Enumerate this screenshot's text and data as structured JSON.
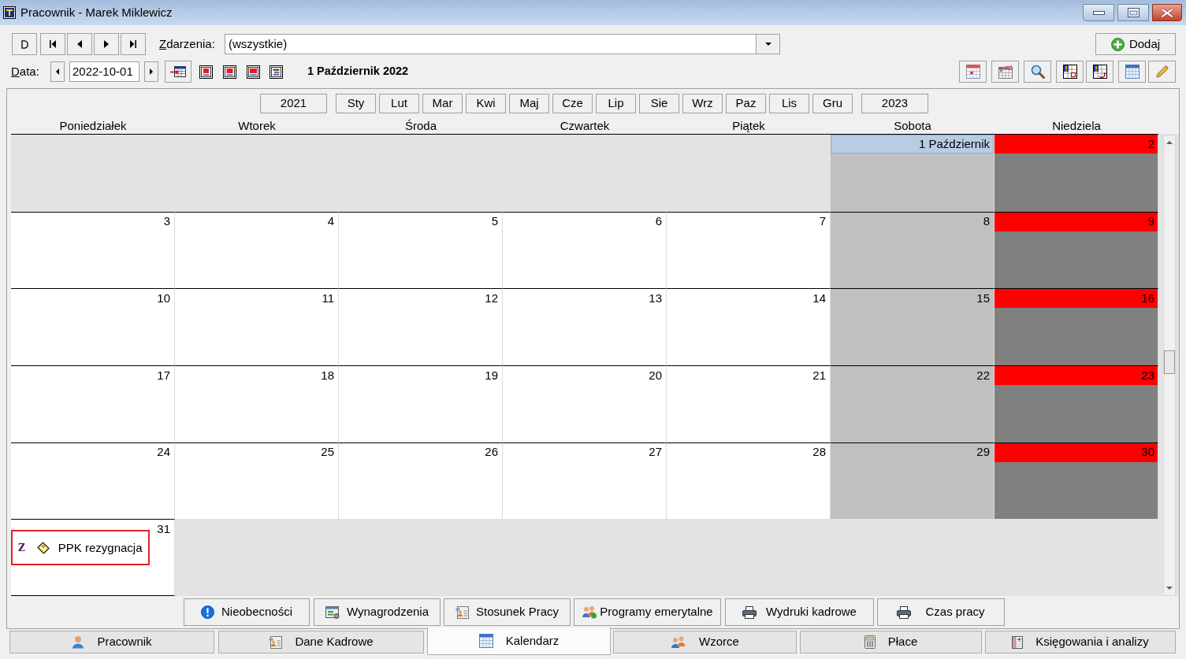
{
  "window": {
    "title": "Pracownik - Marek Miklewicz"
  },
  "toolbar": {
    "events_label": "Zdarzenia:",
    "events_filter": {
      "value": "(wszystkie)"
    },
    "add_button": "Dodaj"
  },
  "date_bar": {
    "label": "Data:",
    "date": {
      "value": "2022-10-01"
    },
    "heading": "1 Październik 2022"
  },
  "period_bar": {
    "previous_year": "2021",
    "months": [
      "Sty",
      "Lut",
      "Mar",
      "Kwi",
      "Maj",
      "Cze",
      "Lip",
      "Sie",
      "Wrz",
      "Paz",
      "Lis",
      "Gru"
    ],
    "next_year": "2023"
  },
  "calendar": {
    "weekdays": [
      "Poniedziałek",
      "Wtorek",
      "Środa",
      "Czwartek",
      "Piątek",
      "Sobota",
      "Niedziela"
    ],
    "weeks": [
      {
        "days": [
          {
            "kind": "outside"
          },
          {
            "kind": "outside"
          },
          {
            "kind": "outside"
          },
          {
            "kind": "outside"
          },
          {
            "kind": "outside"
          },
          {
            "kind": "saturday",
            "day": "1 Październik",
            "selected": true
          },
          {
            "kind": "sunday",
            "day": "2",
            "selected": false
          }
        ]
      },
      {
        "days": [
          {
            "kind": "weekday",
            "day": "3",
            "selected": false
          },
          {
            "kind": "weekday",
            "day": "4",
            "selected": false
          },
          {
            "kind": "weekday",
            "day": "5",
            "selected": false
          },
          {
            "kind": "weekday",
            "day": "6",
            "selected": false
          },
          {
            "kind": "weekday",
            "day": "7",
            "selected": false
          },
          {
            "kind": "saturday",
            "day": "8",
            "selected": false
          },
          {
            "kind": "sunday",
            "day": "9",
            "selected": false
          }
        ]
      },
      {
        "days": [
          {
            "kind": "weekday",
            "day": "10",
            "selected": false
          },
          {
            "kind": "weekday",
            "day": "11",
            "selected": false
          },
          {
            "kind": "weekday",
            "day": "12",
            "selected": false
          },
          {
            "kind": "weekday",
            "day": "13",
            "selected": false
          },
          {
            "kind": "weekday",
            "day": "14",
            "selected": false
          },
          {
            "kind": "saturday",
            "day": "15",
            "selected": false
          },
          {
            "kind": "sunday",
            "day": "16",
            "selected": false
          }
        ]
      },
      {
        "days": [
          {
            "kind": "weekday",
            "day": "17",
            "selected": false
          },
          {
            "kind": "weekday",
            "day": "18",
            "selected": false
          },
          {
            "kind": "weekday",
            "day": "19",
            "selected": false
          },
          {
            "kind": "weekday",
            "day": "20",
            "selected": false
          },
          {
            "kind": "weekday",
            "day": "21",
            "selected": false
          },
          {
            "kind": "saturday",
            "day": "22",
            "selected": false
          },
          {
            "kind": "sunday",
            "day": "23",
            "selected": false
          }
        ]
      },
      {
        "days": [
          {
            "kind": "weekday",
            "day": "24",
            "selected": false
          },
          {
            "kind": "weekday",
            "day": "25",
            "selected": false
          },
          {
            "kind": "weekday",
            "day": "26",
            "selected": false
          },
          {
            "kind": "weekday",
            "day": "27",
            "selected": false
          },
          {
            "kind": "weekday",
            "day": "28",
            "selected": false
          },
          {
            "kind": "saturday",
            "day": "29",
            "selected": false
          },
          {
            "kind": "sunday",
            "day": "30",
            "selected": false
          }
        ]
      },
      {
        "days": [
          {
            "kind": "weekday",
            "day": "31",
            "selected": false,
            "events": [
              {
                "marker": "Z",
                "title": "PPK rezygnacja",
                "selected": true
              }
            ]
          },
          {
            "kind": "outside"
          },
          {
            "kind": "outside"
          },
          {
            "kind": "outside"
          },
          {
            "kind": "outside"
          },
          {
            "kind": "outside"
          },
          {
            "kind": "outside"
          }
        ]
      }
    ]
  },
  "section_buttons": [
    "Nieobecności",
    "Wynagrodzenia",
    "Stosunek Pracy",
    "Programy emerytalne",
    "Wydruki kadrowe",
    "Czas pracy"
  ],
  "tabs": [
    {
      "label": "Pracownik",
      "selected": false
    },
    {
      "label": "Dane Kadrowe",
      "selected": false
    },
    {
      "label": "Kalendarz",
      "selected": true
    },
    {
      "label": "Wzorce",
      "selected": false
    },
    {
      "label": "Płace",
      "selected": false
    },
    {
      "label": "Księgowania i analizy",
      "selected": false
    }
  ]
}
